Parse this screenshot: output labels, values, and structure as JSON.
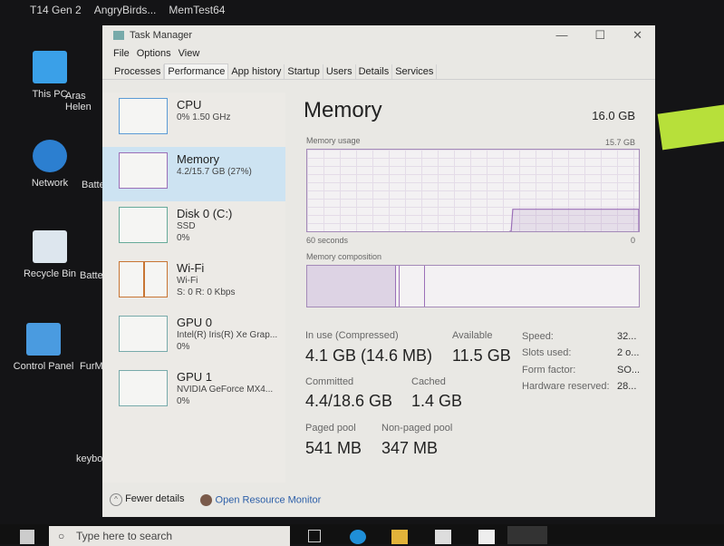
{
  "desktop": {
    "top_items": [
      "T14 Gen 2",
      "AngryBirds...",
      "MemTest64"
    ],
    "icons": [
      {
        "label": "This PC"
      },
      {
        "label": "Network"
      },
      {
        "label": "Recycle Bin"
      },
      {
        "label": "Control Panel"
      }
    ],
    "icons_col2": [
      {
        "label": "Aras Helen"
      },
      {
        "label": "Batter"
      },
      {
        "label": "Batter"
      },
      {
        "label": "FurM"
      },
      {
        "label": "keybo"
      }
    ]
  },
  "window": {
    "title": "Task Manager",
    "menu": [
      "File",
      "Options",
      "View"
    ],
    "tabs": [
      "Processes",
      "Performance",
      "App history",
      "Startup",
      "Users",
      "Details",
      "Services"
    ],
    "active_tab": "Performance"
  },
  "sidebar": [
    {
      "name": "CPU",
      "sub1": "0% 1.50 GHz",
      "sub2": ""
    },
    {
      "name": "Memory",
      "sub1": "4.2/15.7 GB (27%)",
      "sub2": ""
    },
    {
      "name": "Disk 0 (C:)",
      "sub1": "SSD",
      "sub2": "0%"
    },
    {
      "name": "Wi-Fi",
      "sub1": "Wi-Fi",
      "sub2": "S: 0 R: 0 Kbps"
    },
    {
      "name": "GPU 0",
      "sub1": "Intel(R) Iris(R) Xe Grap...",
      "sub2": "0%"
    },
    {
      "name": "GPU 1",
      "sub1": "NVIDIA GeForce MX4...",
      "sub2": "0%"
    }
  ],
  "memory": {
    "title": "Memory",
    "capacity": "16.0 GB",
    "usage_label": "Memory usage",
    "usage_max": "15.7 GB",
    "usage_percent": 27,
    "time_left": "60 seconds",
    "time_right": "0",
    "composition_label": "Memory composition",
    "in_use_label": "In use (Compressed)",
    "in_use": "4.1 GB (14.6 MB)",
    "available_label": "Available",
    "available": "11.5 GB",
    "committed_label": "Committed",
    "committed": "4.4/18.6 GB",
    "cached_label": "Cached",
    "cached": "1.4 GB",
    "paged_label": "Paged pool",
    "paged": "541 MB",
    "nonpaged_label": "Non-paged pool",
    "nonpaged": "347 MB",
    "specs": [
      {
        "k": "Speed:",
        "v": "32..."
      },
      {
        "k": "Slots used:",
        "v": "2 o..."
      },
      {
        "k": "Form factor:",
        "v": "SO..."
      },
      {
        "k": "Hardware reserved:",
        "v": "28..."
      }
    ]
  },
  "footer": {
    "fewer": "Fewer details",
    "monitor": "Open Resource Monitor"
  },
  "taskbar": {
    "search_placeholder": "Type here to search"
  },
  "colors": {
    "memory_accent": "#9b6fb8",
    "selected": "#cde3f2"
  }
}
